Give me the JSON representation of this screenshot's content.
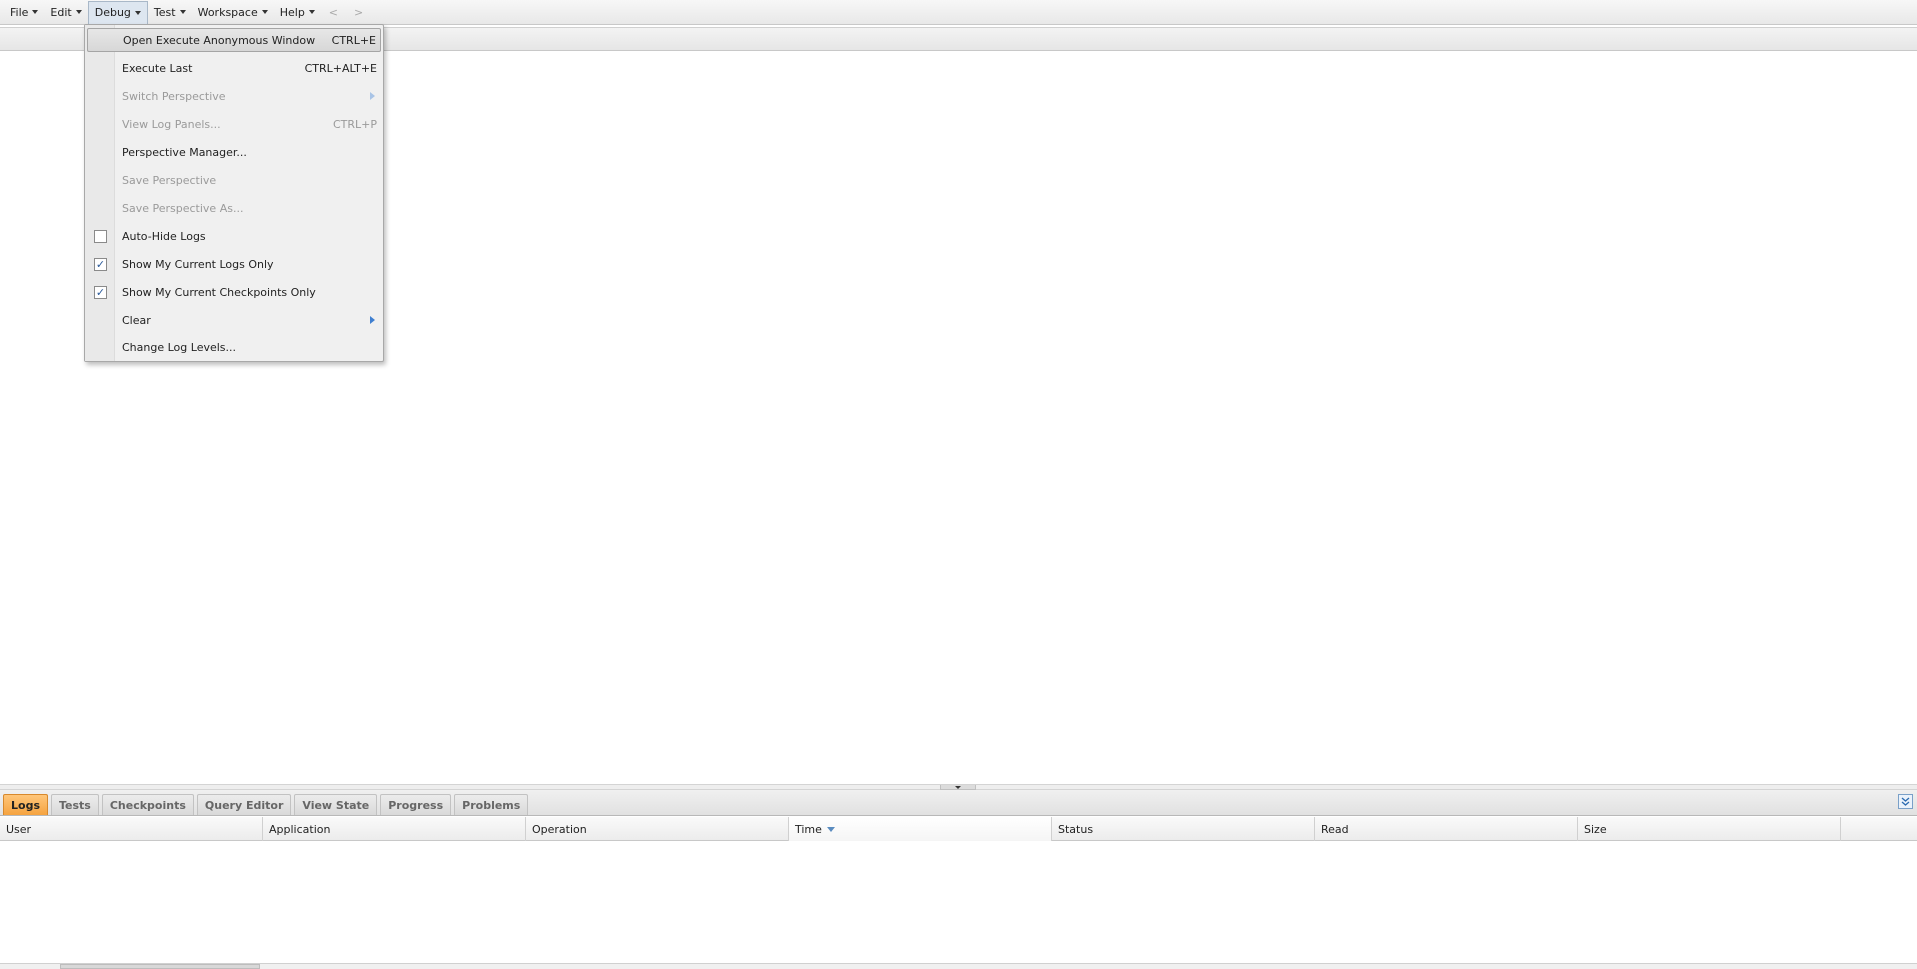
{
  "menubar": {
    "items": [
      {
        "label": "File"
      },
      {
        "label": "Edit"
      },
      {
        "label": "Debug"
      },
      {
        "label": "Test"
      },
      {
        "label": "Workspace"
      },
      {
        "label": "Help"
      }
    ],
    "back": "<",
    "forward": ">"
  },
  "debug_menu": {
    "open_anon": {
      "label": "Open Execute Anonymous Window",
      "shortcut": "CTRL+E"
    },
    "execute_last": {
      "label": "Execute Last",
      "shortcut": "CTRL+ALT+E"
    },
    "switch_perspective": {
      "label": "Switch Perspective"
    },
    "view_log_panels": {
      "label": "View Log Panels...",
      "shortcut": "CTRL+P"
    },
    "perspective_manager": {
      "label": "Perspective Manager..."
    },
    "save_perspective": {
      "label": "Save Perspective"
    },
    "save_perspective_as": {
      "label": "Save Perspective As..."
    },
    "auto_hide_logs": {
      "label": "Auto-Hide Logs",
      "checked": false
    },
    "show_current_logs": {
      "label": "Show My Current Logs Only",
      "checked": true
    },
    "show_current_checkpoints": {
      "label": "Show My Current Checkpoints Only",
      "checked": true
    },
    "clear": {
      "label": "Clear"
    },
    "change_log_levels": {
      "label": "Change Log Levels..."
    },
    "check_mark": "✓"
  },
  "bottom_tabs": [
    {
      "label": "Logs"
    },
    {
      "label": "Tests"
    },
    {
      "label": "Checkpoints"
    },
    {
      "label": "Query Editor"
    },
    {
      "label": "View State"
    },
    {
      "label": "Progress"
    },
    {
      "label": "Problems"
    }
  ],
  "log_table": {
    "columns": [
      {
        "label": "User"
      },
      {
        "label": "Application"
      },
      {
        "label": "Operation"
      },
      {
        "label": "Time"
      },
      {
        "label": "Status"
      },
      {
        "label": "Read"
      },
      {
        "label": "Size"
      }
    ],
    "rows": []
  },
  "colors": {
    "active_tab": "#f5a340",
    "submenu_arrow": "#3f7fd0"
  }
}
